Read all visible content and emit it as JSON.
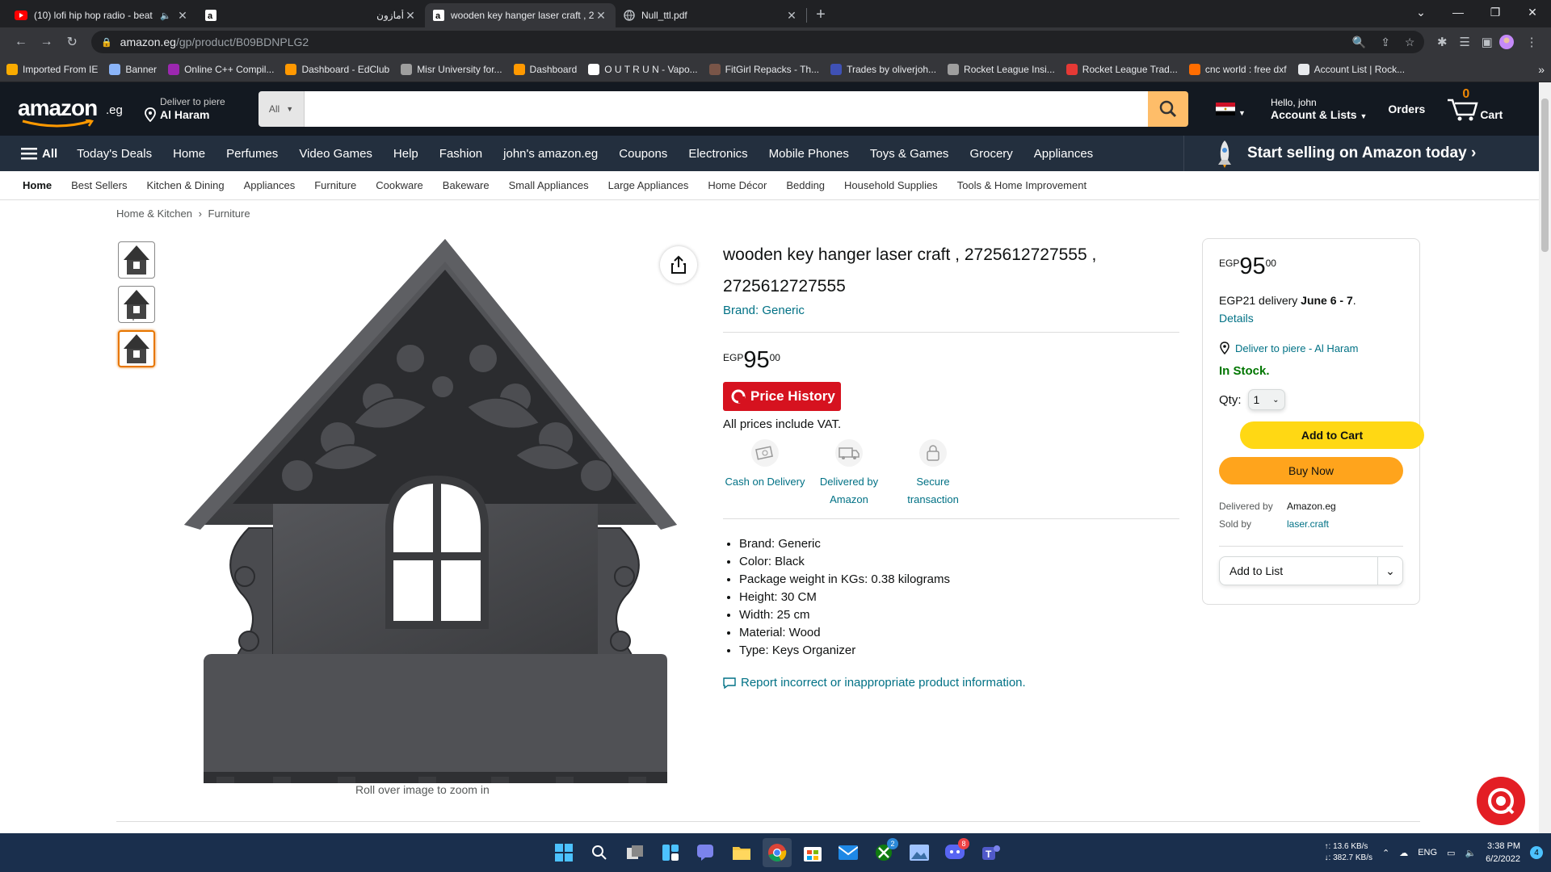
{
  "browser": {
    "tabs": [
      {
        "title": "(10) lofi hip hop radio - beat",
        "icon": "youtube-icon",
        "active": false
      },
      {
        "title": "",
        "icon": "amazon-icon",
        "active": false
      },
      {
        "title": "أمازون",
        "icon": "",
        "active": false
      },
      {
        "title": "wooden key hanger laser craft , 2",
        "icon": "amazon-icon",
        "active": true
      },
      {
        "title": "Null_ttl.pdf",
        "icon": "globe-icon",
        "active": false
      }
    ],
    "url_domain": "amazon.eg",
    "url_path": "/gp/product/B09BDNPLG2",
    "bookmarks": [
      {
        "label": "Imported From IE",
        "color": "#f9ab00"
      },
      {
        "label": "Banner",
        "color": "#8ab4f8"
      },
      {
        "label": "Online C++ Compil...",
        "color": "#9c27b0"
      },
      {
        "label": "Dashboard - EdClub",
        "color": "#ff9800"
      },
      {
        "label": "Misr University for...",
        "color": "#9e9e9e"
      },
      {
        "label": "Dashboard",
        "color": "#ff9900"
      },
      {
        "label": "O U T R U N - Vapo...",
        "color": "#ffffff"
      },
      {
        "label": "FitGirl Repacks - Th...",
        "color": "#795548"
      },
      {
        "label": "Trades by oliverjoh...",
        "color": "#3f51b5"
      },
      {
        "label": "Rocket League Insi...",
        "color": "#9e9e9e"
      },
      {
        "label": "Rocket League Trad...",
        "color": "#e53935"
      },
      {
        "label": "cnc world : free dxf",
        "color": "#ff6d00"
      },
      {
        "label": "Account List | Rock...",
        "color": "#e8eaed"
      }
    ]
  },
  "header": {
    "logo": "amazon",
    "logo_suffix": ".eg",
    "deliver_line1": "Deliver to piere",
    "deliver_line2": "Al Haram",
    "search_category": "All",
    "search_value": "",
    "account_line1": "Hello, john",
    "account_line2": "Account & Lists",
    "orders": "Orders",
    "cart_count": "0",
    "cart_label": "Cart"
  },
  "nav": {
    "all_label": "All",
    "items": [
      "Today's Deals",
      "Home",
      "Perfumes",
      "Video Games",
      "Help",
      "Fashion",
      "john's amazon.eg",
      "Coupons",
      "Electronics",
      "Mobile Phones",
      "Toys & Games",
      "Grocery",
      "Appliances"
    ],
    "sell_banner": "Start selling on Amazon today ›"
  },
  "subnav": [
    "Home",
    "Best Sellers",
    "Kitchen & Dining",
    "Appliances",
    "Furniture",
    "Cookware",
    "Bakeware",
    "Small Appliances",
    "Large Appliances",
    "Home Décor",
    "Bedding",
    "Household Supplies",
    "Tools & Home Improvement"
  ],
  "breadcrumb": {
    "first": "Home & Kitchen",
    "sep": "›",
    "second": "Furniture"
  },
  "product": {
    "title": "wooden key hanger laser craft , 2725612727555 , 2725612727555",
    "brand": "Brand: Generic",
    "price_symbol": "EGP",
    "price_whole": "95",
    "price_fraction": "00",
    "price_history": "Price History",
    "vat": "All prices include VAT.",
    "badges": [
      {
        "label": "Cash on Delivery",
        "icon": "cash-icon"
      },
      {
        "label": "Delivered by Amazon",
        "icon": "truck-icon"
      },
      {
        "label": "Secure transaction",
        "icon": "lock-icon"
      }
    ],
    "bullets": [
      "Brand: Generic",
      "Color: Black",
      "Package weight in KGs: 0.38 kilograms",
      "Height: 30 CM",
      "Width: 25 cm",
      "Material: Wood",
      "Type: Keys Organizer"
    ],
    "report": "Report incorrect or inappropriate product information.",
    "zoom_hint": "Roll over image to zoom in"
  },
  "buybox": {
    "price_symbol": "EGP",
    "price_whole": "95",
    "price_fraction": "00",
    "delivery_prefix": "EGP21 delivery",
    "delivery_dates": "June 6 - 7",
    "delivery_suffix": ".",
    "details": "Details",
    "location": "Deliver to piere - Al Haram",
    "stock": "In Stock.",
    "qty_label": "Qty:",
    "qty_value": "1",
    "add_to_cart": "Add to Cart",
    "buy_now": "Buy Now",
    "delivered_by_label": "Delivered by",
    "delivered_by_value": "Amazon.eg",
    "sold_by_label": "Sold by",
    "sold_by_value": "laser.craft",
    "add_to_list": "Add to List"
  },
  "taskbar": {
    "upload": "↑: 13.6 KB/s",
    "download": "↓: 382.7 KB/s",
    "lang": "ENG",
    "time": "3:38 PM",
    "date": "6/2/2022",
    "notif_count": "4",
    "xbox_badge": "2",
    "discord_badge": "8"
  }
}
